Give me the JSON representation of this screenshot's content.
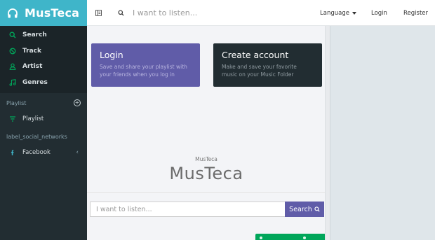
{
  "brand": {
    "title": "MusTeca"
  },
  "nav": {
    "main_items": [
      {
        "label": "Search",
        "icon": "search-icon"
      },
      {
        "label": "Track",
        "icon": "ban-icon"
      },
      {
        "label": "Artist",
        "icon": "user-icon"
      },
      {
        "label": "Genres",
        "icon": "music-note-icon"
      }
    ],
    "playlist_section": "Playlist",
    "playlist_item": "Playlist",
    "social_section": "label_social_networks",
    "facebook_item": "Facebook"
  },
  "header": {
    "search_placeholder": "I want to listen...",
    "language_label": "Language",
    "login_label": "Login",
    "register_label": "Register"
  },
  "cards": {
    "login": {
      "title": "Login",
      "desc": "Save and share your playlist with your friends when you log in"
    },
    "create": {
      "title": "Create account",
      "desc": "Make and save your favorite music on your Music Folder"
    }
  },
  "hero": {
    "small_title": "MusTeca",
    "big_title": "MusTeca"
  },
  "search_form": {
    "placeholder": "I want to listen...",
    "button_label": "Search"
  },
  "colors": {
    "brand_teal": "#3fb5c9",
    "sidebar_dark": "#222d32",
    "accent_purple": "#605ca8",
    "green": "#00a65a",
    "nav_icon_green": "#00a65a"
  }
}
